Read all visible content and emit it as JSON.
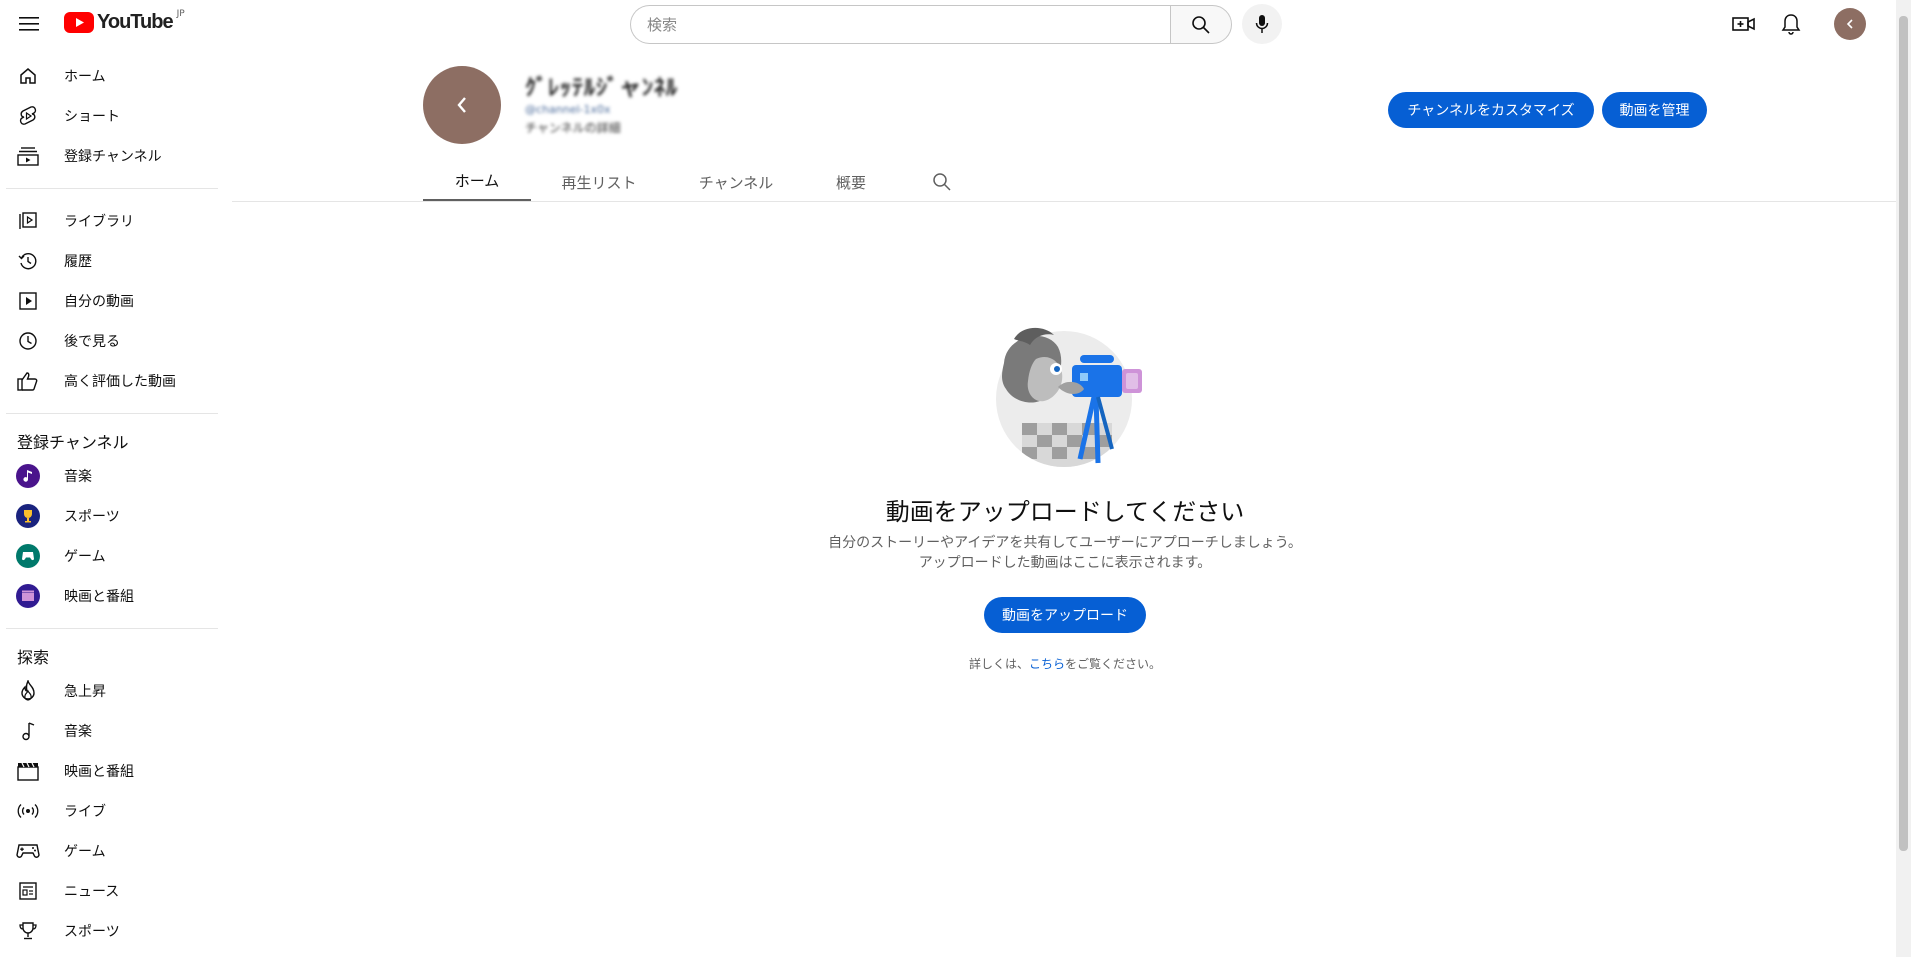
{
  "header": {
    "logo_text": "YouTube",
    "logo_region": "JP",
    "search_placeholder": "検索"
  },
  "sidebar": {
    "main": [
      {
        "label": "ホーム",
        "icon": "home-icon"
      },
      {
        "label": "ショート",
        "icon": "shorts-icon"
      },
      {
        "label": "登録チャンネル",
        "icon": "subscriptions-icon"
      }
    ],
    "you": [
      {
        "label": "ライブラリ",
        "icon": "library-icon"
      },
      {
        "label": "履歴",
        "icon": "history-icon"
      },
      {
        "label": "自分の動画",
        "icon": "your-videos-icon"
      },
      {
        "label": "後で見る",
        "icon": "watch-later-icon"
      },
      {
        "label": "高く評価した動画",
        "icon": "liked-icon"
      }
    ],
    "subscriptions_heading": "登録チャンネル",
    "subscriptions": [
      {
        "label": "音楽",
        "icon": "music-channel-avatar",
        "color": "#4a148c"
      },
      {
        "label": "スポーツ",
        "icon": "sports-channel-avatar",
        "color": "#1a237e"
      },
      {
        "label": "ゲーム",
        "icon": "gaming-channel-avatar",
        "color": "#00796b"
      },
      {
        "label": "映画と番組",
        "icon": "movies-channel-avatar",
        "color": "#311b92"
      }
    ],
    "explore_heading": "探索",
    "explore": [
      {
        "label": "急上昇",
        "icon": "trending-icon"
      },
      {
        "label": "音楽",
        "icon": "music-icon"
      },
      {
        "label": "映画と番組",
        "icon": "clapperboard-icon"
      },
      {
        "label": "ライブ",
        "icon": "live-icon"
      },
      {
        "label": "ゲーム",
        "icon": "gaming-icon"
      },
      {
        "label": "ニュース",
        "icon": "news-icon"
      },
      {
        "label": "スポーツ",
        "icon": "trophy-icon"
      }
    ]
  },
  "channel": {
    "name": "ｸﾞﾚｯﾃﾙｼﾞャﾝﾈﾙ",
    "meta_line1": "@channel-1x0x",
    "meta_line2": "チャンネルの詳細",
    "customize_label": "チャンネルをカスタマイズ",
    "manage_label": "動画を管理",
    "avatar_color": "#8d6e63"
  },
  "tabs": [
    "ホーム",
    "再生リスト",
    "チャンネル",
    "概要"
  ],
  "active_tab": 0,
  "empty_state": {
    "title": "動画をアップロードしてください",
    "desc_line1": "自分のストーリーやアイデアを共有してユーザーにアプローチしましょう。",
    "desc_line2": "アップロードした動画はここに表示されます。",
    "upload_label": "動画をアップロード",
    "learn_prefix": "詳しくは、",
    "learn_link": "こちら",
    "learn_suffix": "をご覧ください。"
  },
  "colors": {
    "accent": "#065fd4",
    "brand_red": "#ff0000"
  }
}
